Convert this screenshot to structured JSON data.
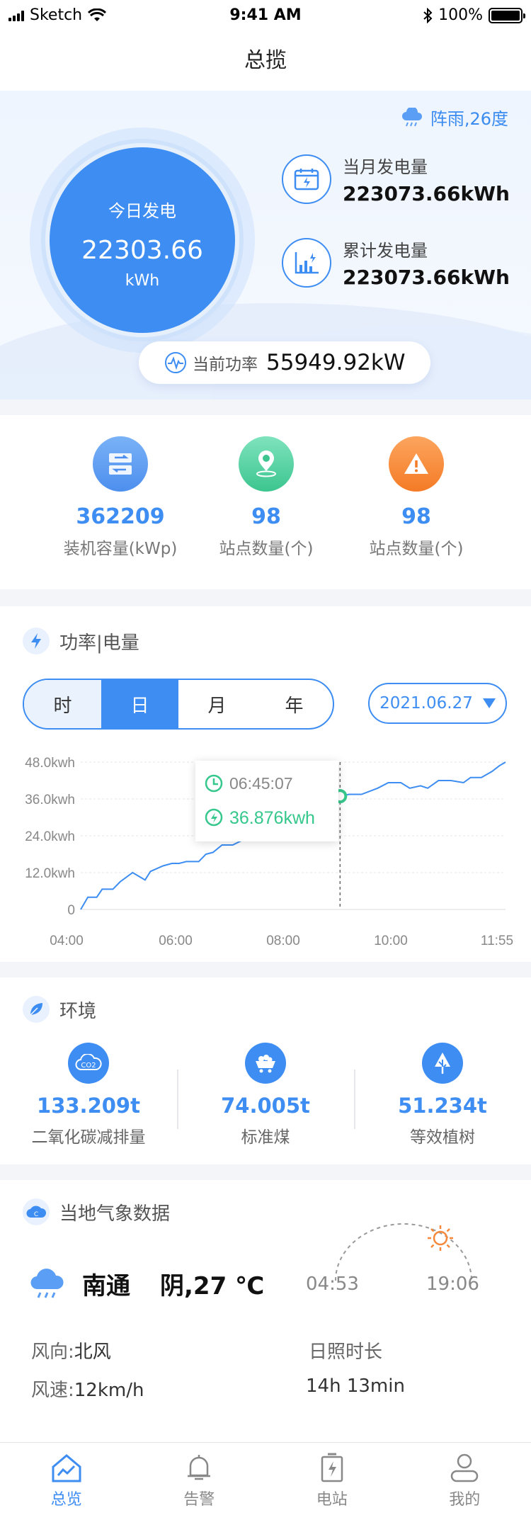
{
  "status_bar": {
    "carrier": "Sketch",
    "time": "9:41 AM",
    "battery": "100%"
  },
  "nav": {
    "title": "总揽"
  },
  "hero": {
    "weather_tag": "阵雨,26度",
    "today": {
      "label": "今日发电",
      "value": "22303.66",
      "unit": "kWh"
    },
    "month": {
      "label": "当月发电量",
      "value": "223073.66kWh"
    },
    "total": {
      "label": "累计发电量",
      "value": "223073.66kWh"
    },
    "power": {
      "label": "当前功率",
      "value": "55949.92kW"
    }
  },
  "kpis": [
    {
      "value": "362209",
      "label": "装机容量(kWp)",
      "icon": "transfer-icon",
      "color": "#5d9cf0"
    },
    {
      "value": "98",
      "label": "站点数量(个)",
      "icon": "location-pin-icon",
      "color": "#4fd0a0"
    },
    {
      "value": "98",
      "label": "站点数量(个)",
      "icon": "warning-icon",
      "color": "#f7883a"
    }
  ],
  "power_section": {
    "title": "功率|电量",
    "segments": [
      "时",
      "日",
      "月",
      "年"
    ],
    "active_segment": "日",
    "date": "2021.06.27",
    "tooltip": {
      "time": "06:45:07",
      "value": "36.876kwh"
    }
  },
  "chart_data": {
    "type": "line",
    "x_ticks": [
      "04:00",
      "06:00",
      "08:00",
      "10:00",
      "11:55"
    ],
    "y_ticks": [
      "0",
      "12.0kwh",
      "24.0kwh",
      "36.0kwh",
      "48.0kwh"
    ],
    "ylim": [
      0,
      48
    ],
    "xlim": [
      0,
      475
    ],
    "series": [
      {
        "color": "#3d8df2",
        "points": [
          [
            0,
            0
          ],
          [
            8,
            4
          ],
          [
            18,
            4
          ],
          [
            24,
            6.6
          ],
          [
            36,
            6.6
          ],
          [
            44,
            9
          ],
          [
            58,
            12
          ],
          [
            72,
            9.6
          ],
          [
            78,
            12.4
          ],
          [
            92,
            14.2
          ],
          [
            102,
            15
          ],
          [
            110,
            15
          ],
          [
            118,
            15.6
          ],
          [
            132,
            15.6
          ],
          [
            140,
            18
          ],
          [
            148,
            18.6
          ],
          [
            158,
            21
          ],
          [
            170,
            21
          ],
          [
            184,
            23
          ],
          [
            196,
            26
          ],
          [
            208,
            28.6
          ],
          [
            216,
            30
          ],
          [
            222,
            30.8
          ],
          [
            238,
            33
          ],
          [
            248,
            33.6
          ],
          [
            264,
            34.4
          ],
          [
            276,
            35.5
          ],
          [
            282,
            35.5
          ],
          [
            290,
            36.9
          ],
          [
            300,
            37.5
          ],
          [
            314,
            37.5
          ],
          [
            332,
            39.5
          ],
          [
            344,
            41.3
          ],
          [
            358,
            41.3
          ],
          [
            368,
            39.5
          ],
          [
            380,
            40.3
          ],
          [
            388,
            39.5
          ],
          [
            400,
            42
          ],
          [
            414,
            42
          ],
          [
            428,
            41.3
          ],
          [
            436,
            43
          ],
          [
            448,
            43
          ],
          [
            460,
            45
          ],
          [
            468,
            46.8
          ],
          [
            475,
            48
          ]
        ]
      }
    ],
    "marker": {
      "x": 290,
      "y": 36.9
    }
  },
  "env": {
    "title": "环境",
    "items": [
      {
        "value": "133.209t",
        "label": "二氧化碳减排量",
        "icon": "co2-icon"
      },
      {
        "value": "74.005t",
        "label": "标准煤",
        "icon": "coal-cart-icon"
      },
      {
        "value": "51.234t",
        "label": "等效植树",
        "icon": "tree-icon"
      }
    ]
  },
  "weather": {
    "title": "当地气象数据",
    "city": "南通",
    "condition": "阴,27 ℃",
    "sunrise": "04:53",
    "sunset": "19:06",
    "wind_dir_label": "风向:",
    "wind_dir": "北风",
    "wind_speed_label": "风速:",
    "wind_speed": "12km/h",
    "sunshine_label": "日照时长",
    "sunshine": "14h 13min"
  },
  "tabs": [
    {
      "label": "总览",
      "icon": "home-chart-icon",
      "active": true
    },
    {
      "label": "告警",
      "icon": "bell-icon",
      "active": false
    },
    {
      "label": "电站",
      "icon": "battery-station-icon",
      "active": false
    },
    {
      "label": "我的",
      "icon": "user-icon",
      "active": false
    }
  ]
}
